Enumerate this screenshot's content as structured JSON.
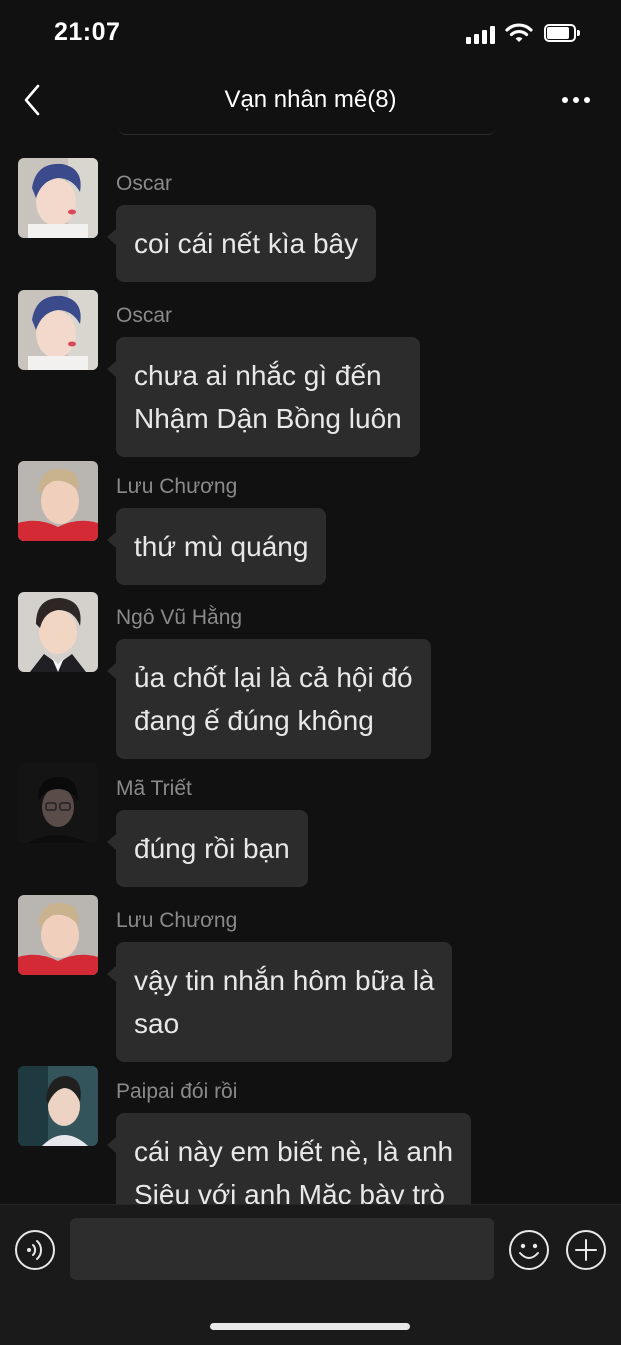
{
  "status": {
    "time": "21:07"
  },
  "header": {
    "title": "Vạn nhân mê(8)"
  },
  "messages": [
    {
      "sender": "Oscar",
      "text": "coi cái nết kìa bây"
    },
    {
      "sender": "Oscar",
      "text": "chưa ai nhắc gì đến\nNhậm Dận Bồng luôn"
    },
    {
      "sender": "Lưu Chương",
      "text": "thứ mù quáng"
    },
    {
      "sender": "Ngô Vũ Hằng",
      "text": "ủa chốt lại là cả hội đó\nđang ế đúng không"
    },
    {
      "sender": "Mã Triết",
      "text": "đúng rồi bạn"
    },
    {
      "sender": "Lưu Chương",
      "text": "vậy tin nhắn hôm bữa là\nsao"
    },
    {
      "sender": "Paipai đói rồi",
      "text": "cái này em biết nè, là anh\nSiêu với anh Mặc bày trò"
    }
  ],
  "input": {
    "value": ""
  },
  "colors": {
    "background": "#111111",
    "bubble": "#2c2c2c",
    "sender": "#8a8a8a"
  },
  "icons": [
    "back-arrow",
    "more-dots",
    "voice",
    "emoji",
    "plus"
  ]
}
